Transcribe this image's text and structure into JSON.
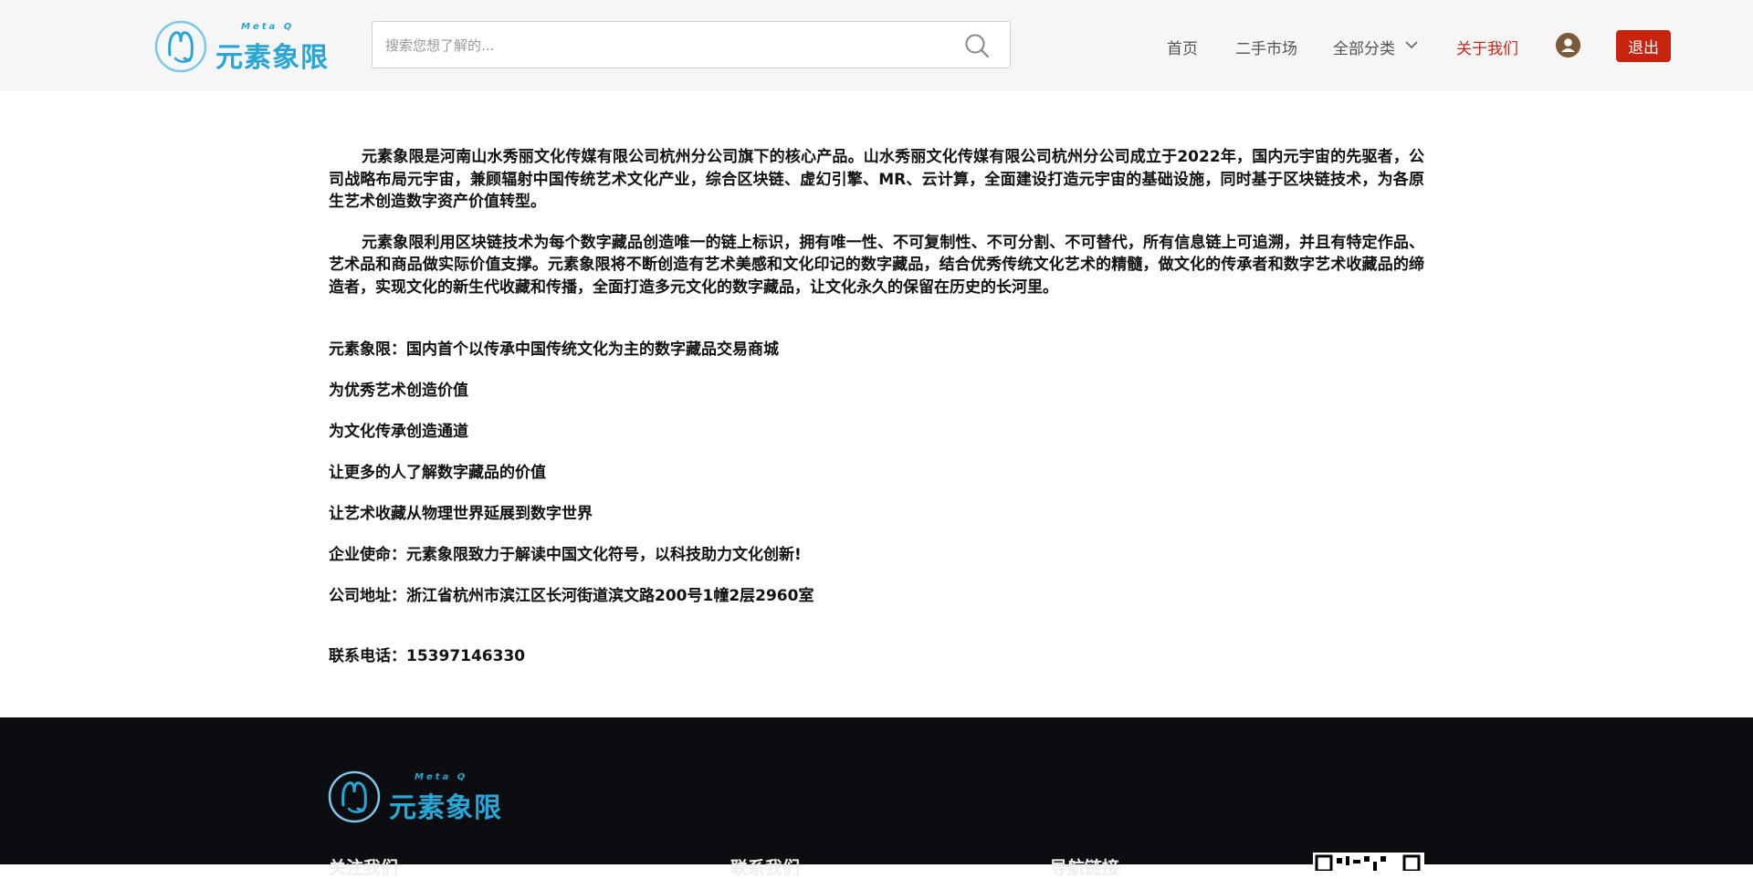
{
  "header": {
    "logo": {
      "tagline": "Meta Q",
      "name": "元素象限"
    },
    "search": {
      "placeholder": "搜索您想了解的..."
    },
    "nav": {
      "home": "首页",
      "market": "二手市场",
      "categories": "全部分类",
      "about": "关于我们"
    },
    "logout_label": "退出"
  },
  "content": {
    "paragraphs": [
      "元素象限是河南山水秀丽文化传媒有限公司杭州分公司旗下的核心产品。山水秀丽文化传媒有限公司杭州分公司成立于2022年，国内元宇宙的先驱者，公司战略布局元宇宙，兼顾辐射中国传统艺术文化产业，综合区块链、虚幻引擎、MR、云计算，全面建设打造元宇宙的基础设施，同时基于区块链技术，为各原生艺术创造数字资产价值转型。",
      "元素象限利用区块链技术为每个数字藏品创造唯一的链上标识，拥有唯一性、不可复制性、不可分割、不可替代，所有信息链上可追溯，并且有特定作品、艺术品和商品做实际价值支撑。元素象限将不断创造有艺术美感和文化印记的数字藏品，结合优秀传统文化艺术的精髓，做文化的传承者和数字艺术收藏品的缔造者，实现文化的新生代收藏和传播，全面打造多元文化的数字藏品，让文化永久的保留在历史的长河里。"
    ],
    "lines": [
      "元素象限：国内首个以传承中国传统文化为主的数字藏品交易商城",
      "为优秀艺术创造价值",
      "为文化传承创造通道",
      "让更多的人了解数字藏品的价值",
      "让艺术收藏从物理世界延展到数字世界",
      "企业使命：元素象限致力于解读中国文化符号，以科技助力文化创新!",
      "公司地址：浙江省杭州市滨江区长河街道滨文路200号1幢2层2960室",
      "联系电话：15397146330"
    ]
  },
  "footer": {
    "logo": {
      "tagline": "Meta Q",
      "name": "元素象限"
    },
    "columns": [
      "关注我们",
      "联系我们",
      "导航链接"
    ]
  },
  "colors": {
    "accent_red": "#c8230f",
    "brand_blue": "#2aa6d6",
    "footer_bg": "#0b0d10",
    "header_bg": "#f6f6f6"
  },
  "icons": [
    "logo-mark-icon",
    "search-icon",
    "chevron-down-icon",
    "user-avatar-icon",
    "qr-code-icon"
  ]
}
